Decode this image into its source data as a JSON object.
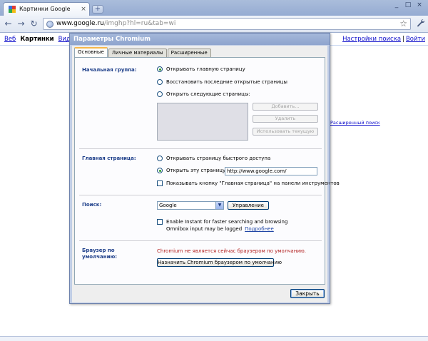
{
  "browser": {
    "tab_title": "Картинки Google",
    "tab_close": "×",
    "new_tab": "+",
    "window_controls": [
      "_",
      "□",
      "×"
    ],
    "url_main": "www.google.ru",
    "url_rest": "/imghp?hl=ru&tab=wi",
    "back_icon": "←",
    "forward_icon": "→",
    "reload_icon": "↻",
    "star_icon": "☆",
    "wrench_icon": "🔧"
  },
  "page": {
    "nav_links": [
      "Веб",
      "Картинки",
      "Видео"
    ],
    "active_nav": "Картинки",
    "right_links": [
      "Настройки поиска",
      "Войти"
    ],
    "separator": "|",
    "advanced_search": "Расширенный поиск"
  },
  "dialog": {
    "title": "Параметры Chromium",
    "tabs": [
      "Основные",
      "Личные материалы",
      "Расширенные"
    ],
    "active_tab": "Основные",
    "startup": {
      "label": "Начальная группа:",
      "options": [
        {
          "label": "Открывать главную страницу",
          "selected": true
        },
        {
          "label": "Восстановить последние открытые страницы",
          "selected": false
        },
        {
          "label": "Открыть следующие страницы:",
          "selected": false
        }
      ],
      "buttons": [
        "Добавить...",
        "Удалить",
        "Использовать текущую"
      ]
    },
    "homepage": {
      "label": "Главная страница:",
      "options": [
        {
          "label": "Открывать страницу быстрого доступа",
          "selected": false
        },
        {
          "label": "Открыть эту страницу:",
          "selected": true
        }
      ],
      "url_value": "http://www.google.com/",
      "show_home_button": {
        "label": "Показывать кнопку \"Главная страница\" на панели инструментов",
        "checked": false
      }
    },
    "search": {
      "label": "Поиск:",
      "engine": "Google",
      "manage_button": "Управление",
      "instant": {
        "checked": false,
        "line1": "Enable Instant for faster searching and browsing",
        "line2": "Omnibox input may be logged",
        "link": "Подробнее"
      }
    },
    "default_browser": {
      "label": "Браузер по умолчанию:",
      "status": "Chromium не является сейчас браузером по умолчанию.",
      "button": "Назначить Chromium браузером по умолчанию"
    },
    "close_button": "Закрыть"
  },
  "colors": {
    "section_label": "#1e3f8a",
    "warning": "#b21f1f",
    "link": "#1111cc",
    "active_tab_accent": "#f6b74c"
  }
}
